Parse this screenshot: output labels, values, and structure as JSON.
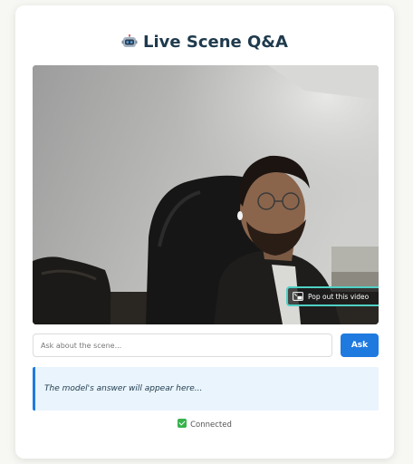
{
  "page": {
    "title": "Live Scene Q&A",
    "title_icon": "robot-icon"
  },
  "video": {
    "popout_label": "Pop out this video",
    "popout_icon": "picture-in-picture-icon"
  },
  "question": {
    "placeholder": "Ask about the scene...",
    "value": ""
  },
  "ask": {
    "label": "Ask"
  },
  "answer": {
    "text": "The model's answer will appear here..."
  },
  "status": {
    "icon": "check-icon",
    "text": "Connected"
  },
  "colors": {
    "accent": "#1f7ae0",
    "title": "#1f3a4d",
    "answer_bg": "#e9f4fd",
    "status_ok": "#37b24d",
    "popout_border": "#4fd1c5"
  }
}
